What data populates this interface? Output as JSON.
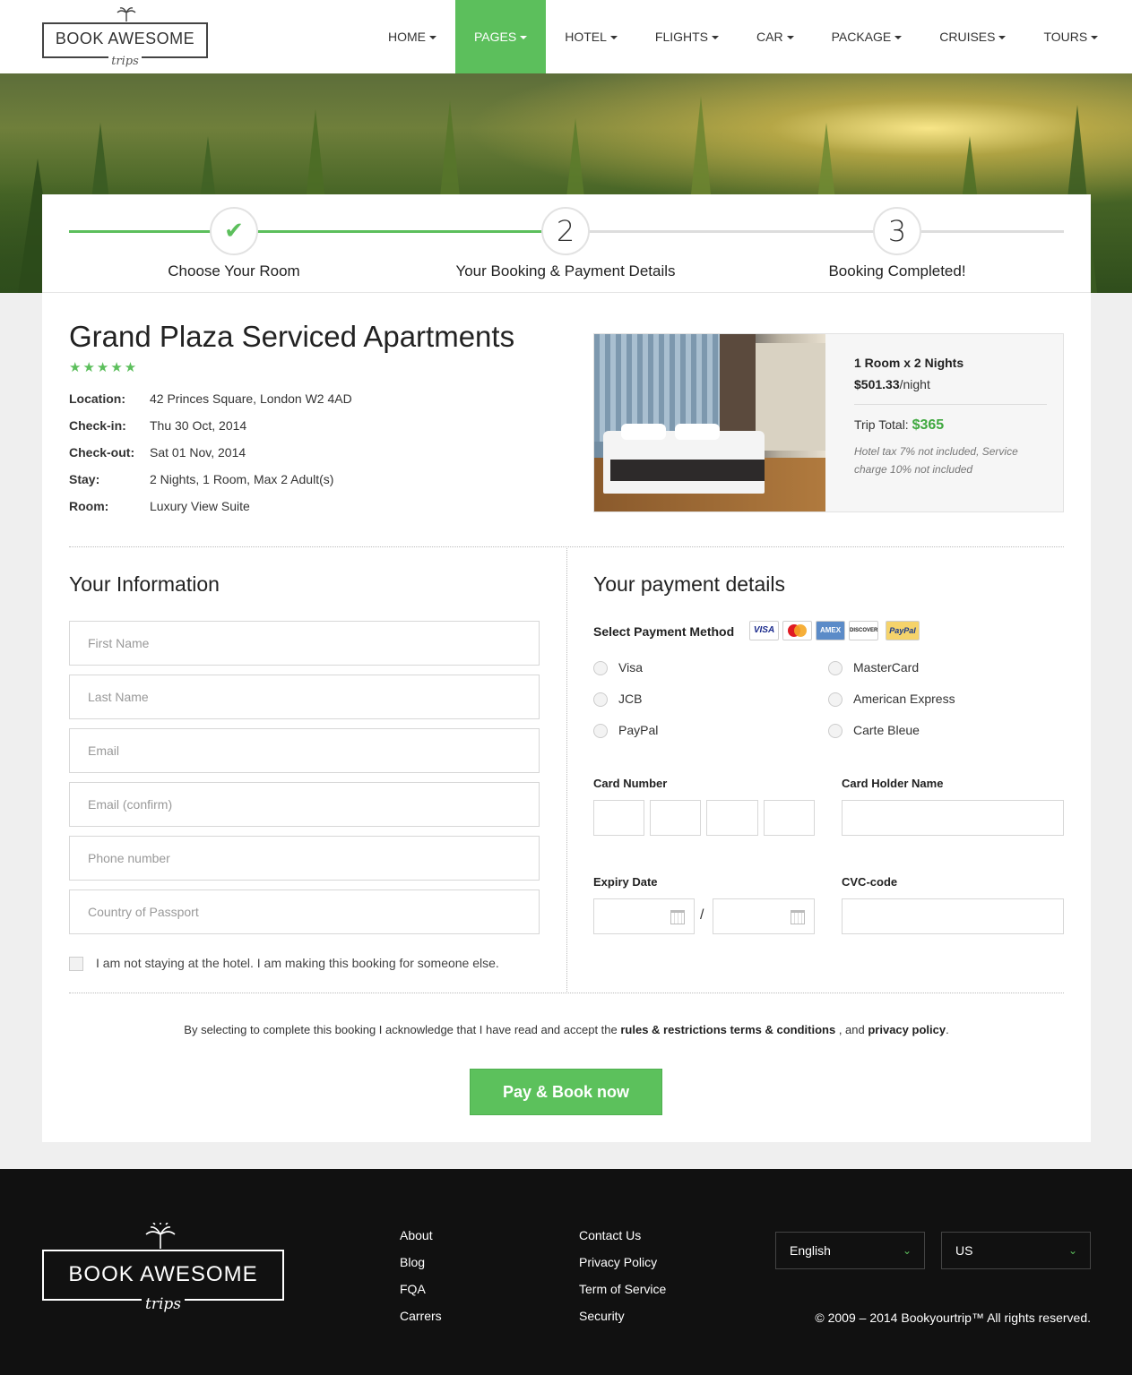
{
  "header": {
    "logo": {
      "brand": "BOOK AWESOME",
      "sub": "trips"
    },
    "nav": [
      "HOME",
      "PAGES",
      "HOTEL",
      "FLIGHTS",
      "CAR",
      "PACKAGE",
      "CRUISES",
      "TOURS"
    ],
    "active_nav": "PAGES"
  },
  "steps": [
    {
      "label": "Choose Your Room",
      "marker": "✔",
      "done": true
    },
    {
      "label": "Your Booking & Payment Details",
      "marker": "2",
      "done": false
    },
    {
      "label": "Booking Completed!",
      "marker": "3",
      "done": false
    }
  ],
  "hotel": {
    "name": "Grand Plaza Serviced Apartments",
    "stars": "★★★★★",
    "details": [
      {
        "key": "Location:",
        "value": "42 Princes Square, London W2 4AD"
      },
      {
        "key": "Check-in:",
        "value": "Thu 30 Oct, 2014"
      },
      {
        "key": "Check-out:",
        "value": "Sat 01 Nov, 2014"
      },
      {
        "key": "Stay:",
        "value": "2 Nights, 1 Room, Max 2 Adult(s)"
      },
      {
        "key": "Room:",
        "value": "Luxury View Suite"
      }
    ]
  },
  "summary": {
    "rooms": "1 Room x 2 Nights",
    "price": "$501.33",
    "per": "/night",
    "total_label": "Trip Total:",
    "total": "$365",
    "note": "Hotel tax 7% not included, Service charge 10% not included"
  },
  "info": {
    "title": "Your Information",
    "placeholders": [
      "First Name",
      "Last Name",
      "Email",
      "Email (confirm)",
      "Phone number",
      "Country of Passport"
    ],
    "checkbox": "I am not staying at the hotel. I am making this booking for someone else."
  },
  "payment": {
    "title": "Your payment details",
    "method_label": "Select Payment Method",
    "card_logos": [
      "VISA",
      "MasterCard",
      "AMEX",
      "DISCOVER",
      "PayPal"
    ],
    "methods": [
      "Visa",
      "MasterCard",
      "JCB",
      "American Express",
      "PayPal",
      "Carte Bleue"
    ],
    "card_number_label": "Card Number",
    "holder_label": "Card Holder Name",
    "expiry_label": "Expiry Date",
    "expiry_sep": "/",
    "cvc_label": "CVC-code"
  },
  "terms": {
    "pre": "By selecting to complete this booking I acknowledge that I have read and accept the ",
    "link1": "rules & restrictions terms & conditions",
    "mid": " , and ",
    "link2": "privacy policy",
    "post": "."
  },
  "pay_button": "Pay & Book now",
  "footer": {
    "logo": {
      "brand": "BOOK AWESOME",
      "sub": "trips"
    },
    "col1": [
      "About",
      "Blog",
      "FQA",
      "Carrers"
    ],
    "col2": [
      "Contact Us",
      "Privacy Policy",
      "Term of Service",
      "Security"
    ],
    "language": "English",
    "region": "US",
    "copyright": "© 2009 – 2014 Bookyourtrip™ All rights reserved."
  },
  "colors": {
    "accent": "#5cbf5c",
    "footer_bg": "#111111"
  }
}
